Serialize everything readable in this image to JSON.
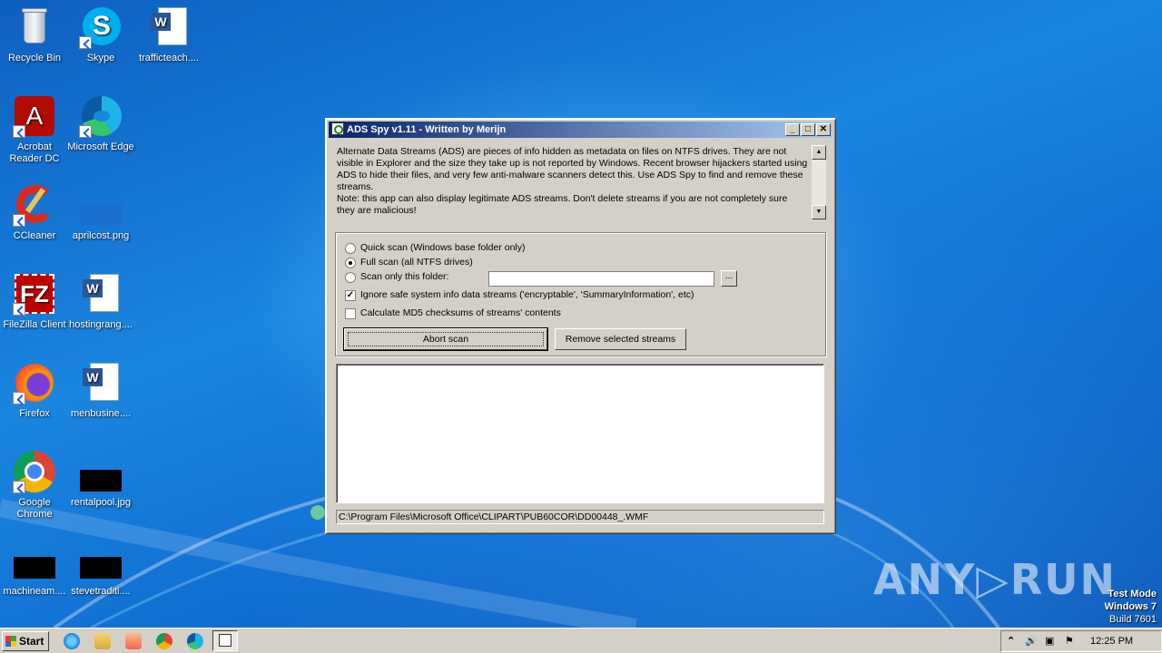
{
  "desktop": {
    "icons": [
      {
        "label": "Recycle Bin",
        "icon": "recycle-bin-icon"
      },
      {
        "label": "Skype",
        "icon": "skype-icon"
      },
      {
        "label": "trafficteach....",
        "icon": "word-document-icon"
      },
      {
        "label": "Acrobat Reader DC",
        "icon": "acrobat-icon"
      },
      {
        "label": "Microsoft Edge",
        "icon": "edge-icon"
      },
      {
        "label": "CCleaner",
        "icon": "ccleaner-icon"
      },
      {
        "label": "aprilcost.png",
        "icon": "image-file-icon"
      },
      {
        "label": "FileZilla Client",
        "icon": "filezilla-icon"
      },
      {
        "label": "hostingrang....",
        "icon": "word-document-icon"
      },
      {
        "label": "Firefox",
        "icon": "firefox-icon"
      },
      {
        "label": "menbusine....",
        "icon": "word-document-icon"
      },
      {
        "label": "Google Chrome",
        "icon": "chrome-icon"
      },
      {
        "label": "rentalpool.jpg",
        "icon": "image-file-icon"
      },
      {
        "label": "machineam....",
        "icon": "image-file-icon"
      },
      {
        "label": "stevetraditi....",
        "icon": "image-file-icon"
      }
    ]
  },
  "window": {
    "title": "ADS Spy v1.11 - Written by Merijn",
    "controls": {
      "minimize": "_",
      "maximize": "□",
      "close": "✕"
    },
    "info_text": "Alternate Data Streams (ADS) are pieces of info hidden as metadata on files on NTFS drives. They are not visible in Explorer and the size they take up is not reported by Windows. Recent browser hijackers started using ADS to hide their files, and very few anti-malware scanners detect this. Use ADS Spy to find and remove these streams.",
    "info_note": "Note: this app can also display legitimate ADS streams. Don't delete streams if you are not completely sure they are malicious!",
    "scroll_up": "▲",
    "scroll_down": "▼",
    "options": {
      "quick_scan": "Quick scan (Windows base folder only)",
      "full_scan": "Full scan (all NTFS drives)",
      "scan_folder": "Scan only this folder:",
      "folder_value": "",
      "browse": "...",
      "ignore_safe": "Ignore safe system info data streams ('encryptable', 'SummaryInformation', etc)",
      "calc_md5": "Calculate MD5 checksums of streams' contents",
      "selected_scan": "full_scan",
      "ignore_safe_checked": true,
      "calc_md5_checked": false
    },
    "buttons": {
      "abort": "Abort scan",
      "remove": "Remove selected streams"
    },
    "status": "C:\\Program Files\\Microsoft Office\\CLIPART\\PUB60COR\\DD00448_.WMF"
  },
  "taskbar": {
    "start_label": "Start",
    "apps": [
      "internet-explorer-icon",
      "explorer-icon",
      "media-player-icon",
      "chrome-icon",
      "edge-icon",
      "ads-spy-icon"
    ],
    "time": "12:25 PM"
  },
  "watermark": "ANY▷RUN",
  "test_mode": {
    "line1": "Test Mode",
    "line2": "Windows 7",
    "line3": "Build 7601"
  }
}
